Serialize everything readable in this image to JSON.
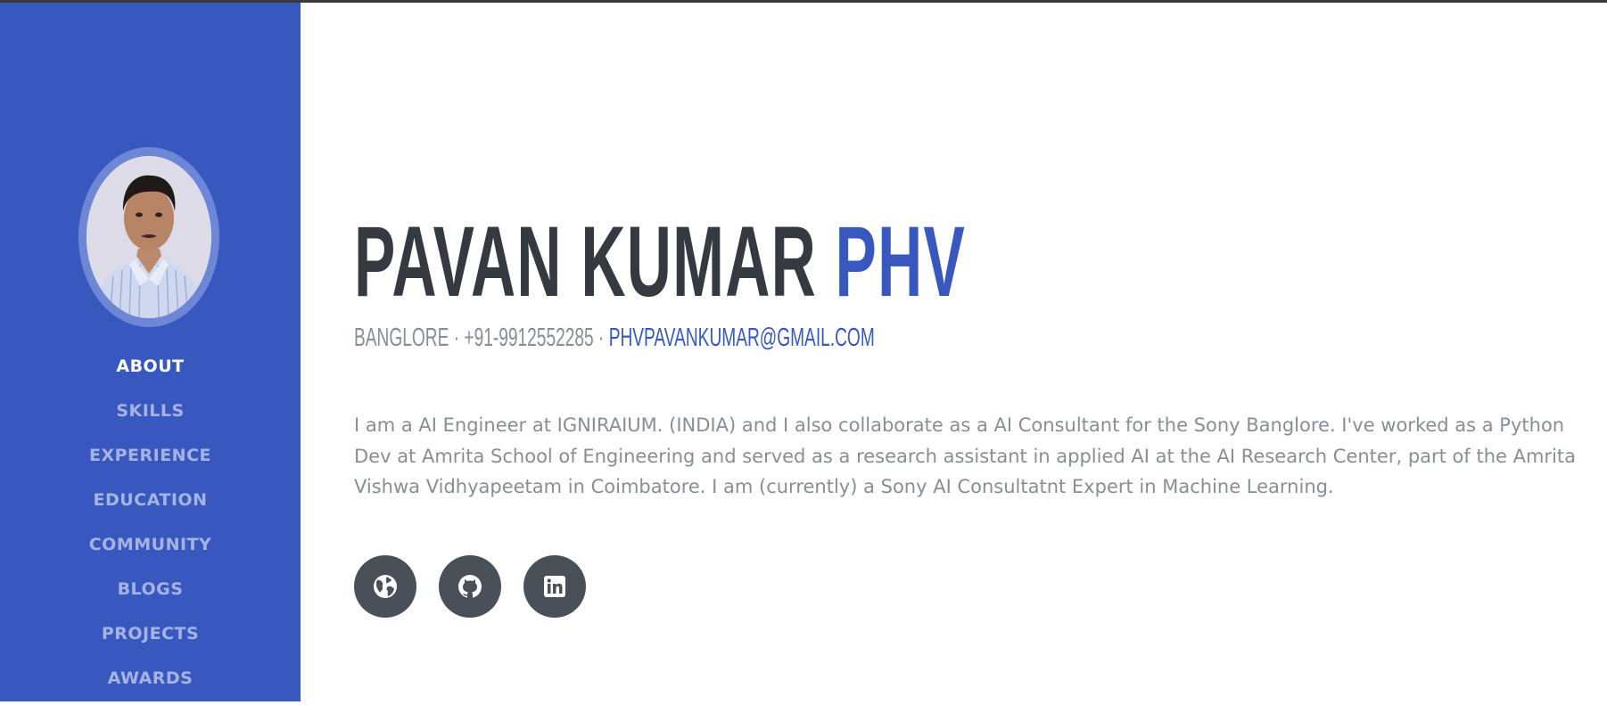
{
  "profile": {
    "photo_alt": "Profile photo",
    "first_name": "PAVAN KUMAR",
    "last_name": "PHV",
    "location": "BANGLORE",
    "phone": "+91-9912552285",
    "separator": " · ",
    "email": "PHVPAVANKUMAR@GMAIL.COM",
    "bio": "I am a AI Engineer at IGNIRAIUM. (INDIA) and I also collaborate as a AI Consultant for the Sony Banglore. I've worked as a Python Dev at Amrita School of Engineering and served as a research assistant in applied AI at the AI Research Center, part of the Amrita Vishwa Vidhyapeetam in Coimbatore. I am (currently) a Sony AI Consultatnt Expert in Machine Learning."
  },
  "nav": {
    "items": [
      {
        "label": "ABOUT",
        "active": true
      },
      {
        "label": "SKILLS"
      },
      {
        "label": "EXPERIENCE"
      },
      {
        "label": "EDUCATION"
      },
      {
        "label": "COMMUNITY"
      },
      {
        "label": "BLOGS"
      },
      {
        "label": "PROJECTS"
      },
      {
        "label": "AWARDS"
      }
    ]
  },
  "social": [
    {
      "icon": "globe-icon"
    },
    {
      "icon": "github-icon"
    },
    {
      "icon": "linkedin-icon"
    }
  ],
  "colors": {
    "primary": "#3858c0",
    "heading": "#343a40",
    "muted": "#868e96",
    "social_bg": "#495057"
  }
}
